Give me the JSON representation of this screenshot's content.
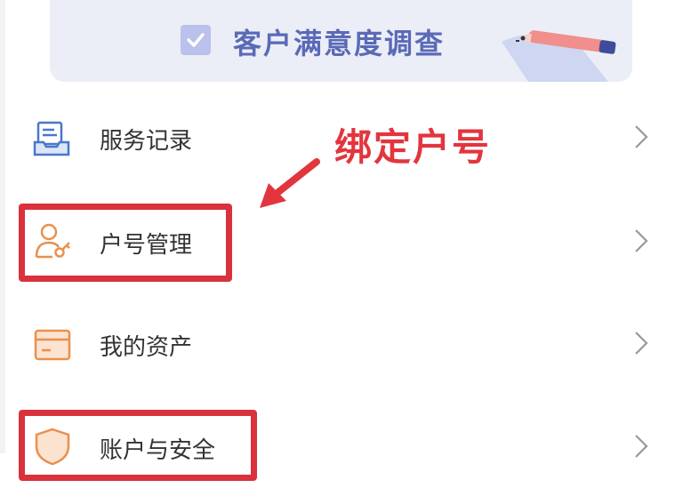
{
  "banner": {
    "title": "客户满意度调查"
  },
  "menu": {
    "items": [
      {
        "label": "服务记录",
        "icon": "document-tray-icon"
      },
      {
        "label": "户号管理",
        "icon": "user-key-icon"
      },
      {
        "label": "我的资产",
        "icon": "card-icon"
      },
      {
        "label": "账户与安全",
        "icon": "shield-icon"
      }
    ]
  },
  "annotation": {
    "text": "绑定户号"
  },
  "colors": {
    "annotation_red": "#d9323c",
    "banner_bg": "#eceef7",
    "banner_text": "#5a6ab7",
    "icon_blue": "#4a78c9",
    "icon_orange": "#e9904f"
  }
}
